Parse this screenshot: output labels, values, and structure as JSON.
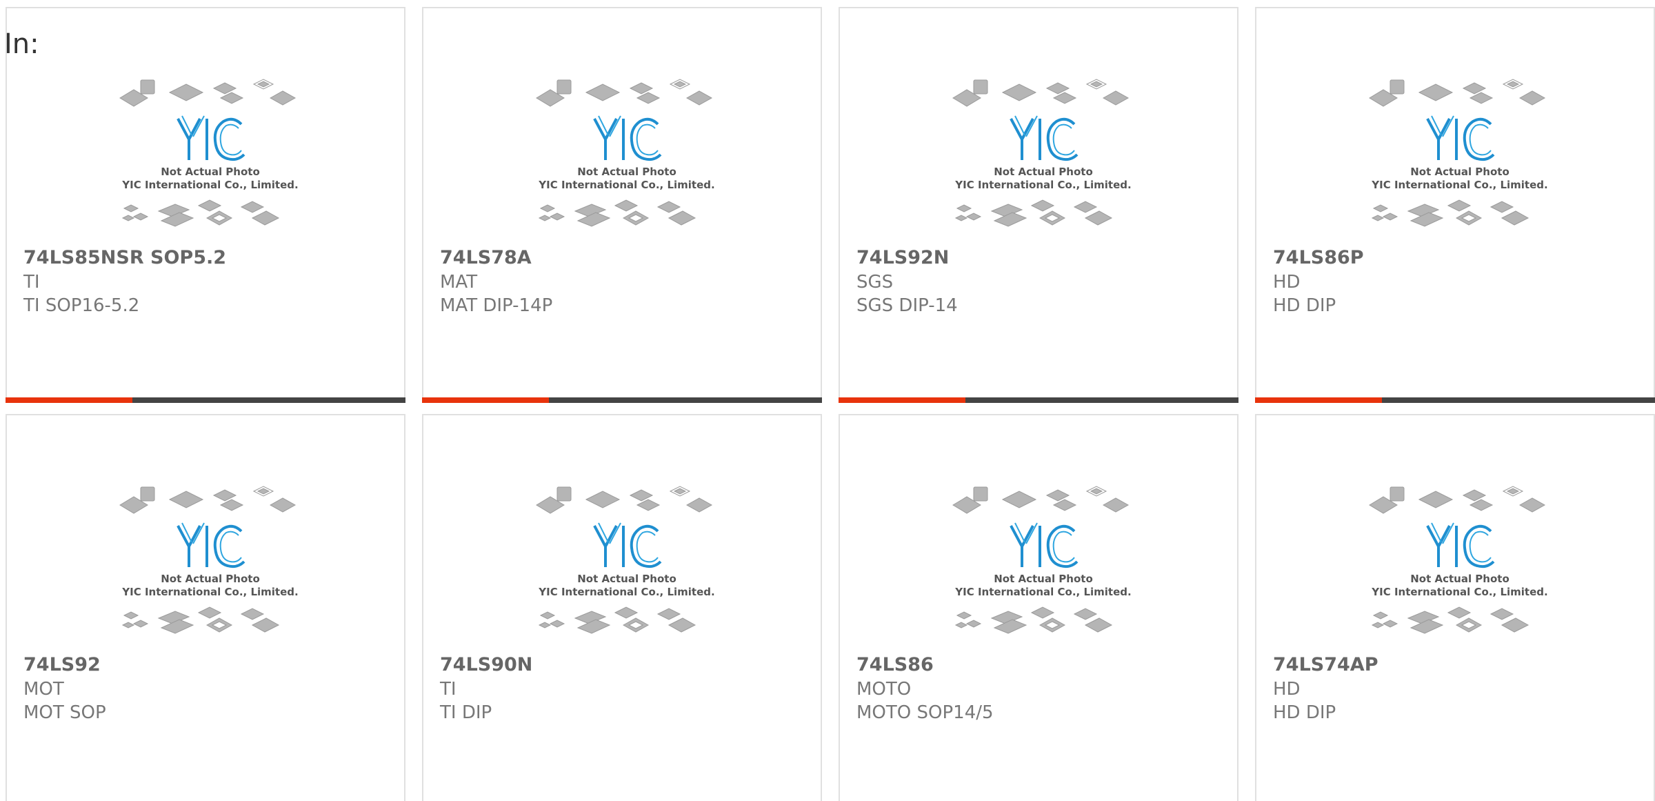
{
  "header": {
    "label": "In:"
  },
  "brand": {
    "logo_text": "YIC",
    "photo_line1": "Not Actual Photo",
    "photo_line2": "YIC International Co., Limited.",
    "logo_color": "#1f8fd0",
    "accent_color": "#e8330c",
    "bar_color": "#444444"
  },
  "products": [
    {
      "part": "74LS85NSR SOP5.2",
      "maker": "TI",
      "package": "TI SOP16-5.2"
    },
    {
      "part": "74LS78A",
      "maker": "MAT",
      "package": "MAT DIP-14P"
    },
    {
      "part": "74LS92N",
      "maker": "SGS",
      "package": "SGS DIP-14"
    },
    {
      "part": "74LS86P",
      "maker": "HD",
      "package": "HD DIP"
    },
    {
      "part": "74LS92",
      "maker": "MOT",
      "package": "MOT SOP"
    },
    {
      "part": "74LS90N",
      "maker": "TI",
      "package": "TI DIP"
    },
    {
      "part": "74LS86",
      "maker": "MOTO",
      "package": "MOTO SOP14/5"
    },
    {
      "part": "74LS74AP",
      "maker": "HD",
      "package": "HD DIP"
    }
  ]
}
